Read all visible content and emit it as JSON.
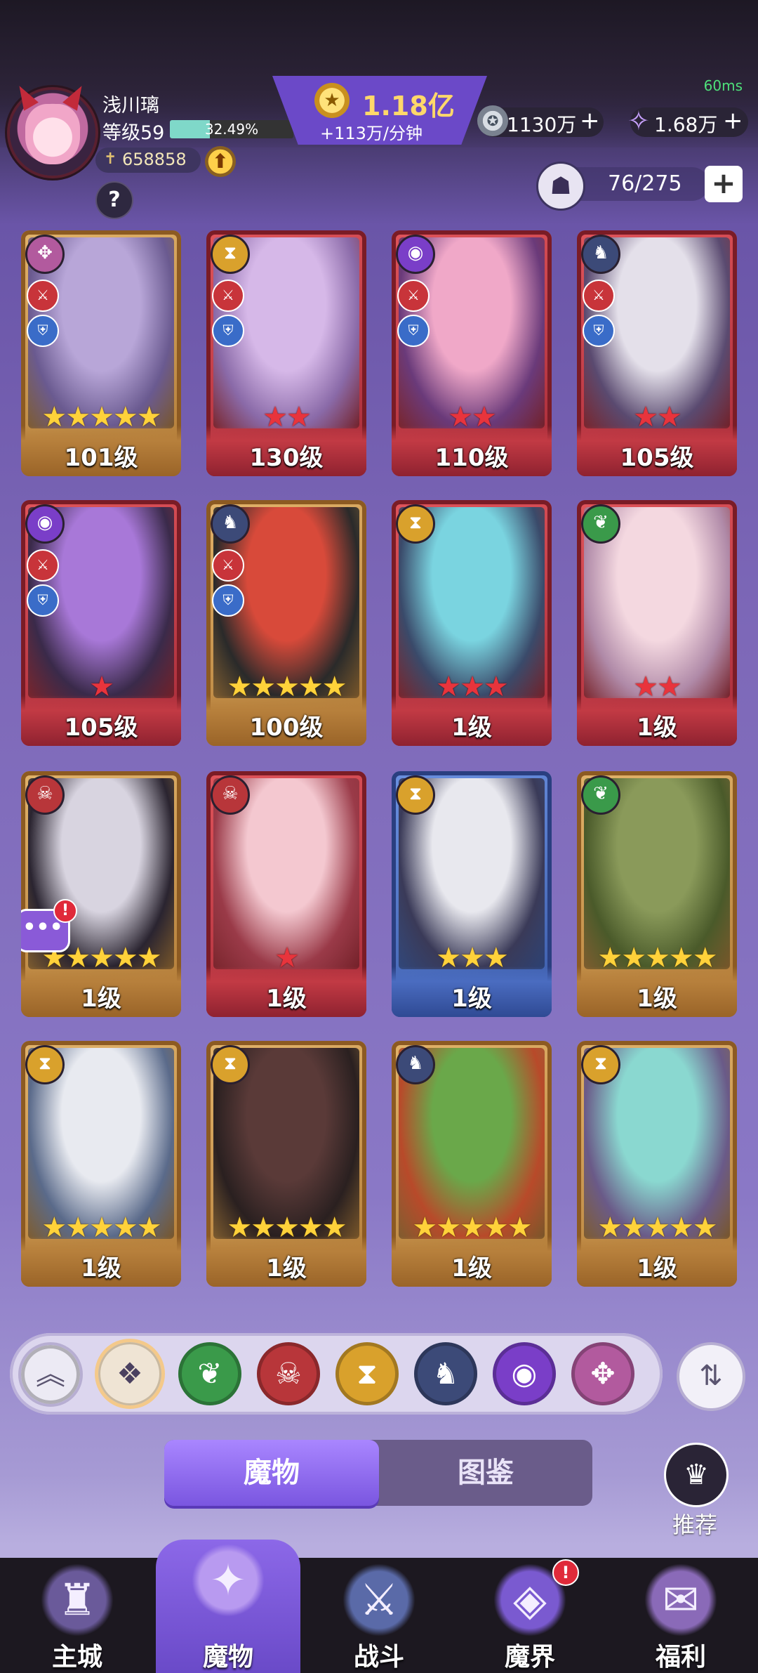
{
  "status": {
    "ping": "60ms"
  },
  "player": {
    "name": "浅川璃",
    "level": "等级59",
    "xp_percent_text": "32.49%",
    "xp_fraction": 0.3249,
    "power": "658858"
  },
  "currencies": {
    "gold": "1.18亿",
    "gold_rate": "+113万/分钟",
    "silver": "1130万",
    "gems": "1.68万",
    "plus": "+"
  },
  "capacity": {
    "text": "76/275",
    "plus": "+"
  },
  "help": "?",
  "factions": {
    "wind": {
      "glyph": "✥",
      "color": "#b25a9e",
      "icon": "wind-swirl-icon"
    },
    "time": {
      "glyph": "⧗",
      "color": "#d9a12c",
      "icon": "hourglass-icon"
    },
    "eye": {
      "glyph": "◉",
      "color": "#7a3ec8",
      "icon": "eye-icon"
    },
    "dragon": {
      "glyph": "♞",
      "color": "#3c4a78",
      "icon": "dragon-icon"
    },
    "leaf": {
      "glyph": "❦",
      "color": "#3a9a4a",
      "icon": "leaf-icon"
    },
    "demon": {
      "glyph": "☠",
      "color": "#b8363a",
      "icon": "demon-mask-icon"
    }
  },
  "cards": [
    {
      "level": "101级",
      "frame": "gold",
      "faction": "wind",
      "stars": 5,
      "star_color": "gold",
      "roles": true,
      "art": [
        "#b8a6d8",
        "#6a5a90"
      ]
    },
    {
      "level": "130级",
      "frame": "red",
      "faction": "time",
      "stars": 2,
      "star_color": "red",
      "roles": true,
      "art": [
        "#d6b8e8",
        "#8a6aa8"
      ]
    },
    {
      "level": "110级",
      "frame": "red",
      "faction": "eye",
      "stars": 2,
      "star_color": "red",
      "roles": true,
      "art": [
        "#f0a8c8",
        "#6a3a7a"
      ]
    },
    {
      "level": "105级",
      "frame": "red",
      "faction": "dragon",
      "stars": 2,
      "star_color": "red",
      "roles": true,
      "art": [
        "#e4e0ea",
        "#5a4a70"
      ]
    },
    {
      "level": "105级",
      "frame": "red",
      "faction": "eye",
      "stars": 1,
      "star_color": "red",
      "roles": true,
      "art": [
        "#a878d8",
        "#3a2a4a"
      ]
    },
    {
      "level": "100级",
      "frame": "gold",
      "faction": "dragon",
      "stars": 5,
      "star_color": "gold",
      "roles": true,
      "art": [
        "#d84a3a",
        "#2a2a2a"
      ]
    },
    {
      "level": "1级",
      "frame": "red",
      "faction": "time",
      "stars": 3,
      "star_color": "red",
      "roles": false,
      "art": [
        "#7ad4e0",
        "#3a4a6a"
      ]
    },
    {
      "level": "1级",
      "frame": "red",
      "faction": "leaf",
      "stars": 2,
      "star_color": "red",
      "roles": false,
      "art": [
        "#f4d8e0",
        "#b08aa8"
      ]
    },
    {
      "level": "1级",
      "frame": "gold",
      "faction": "demon",
      "stars": 5,
      "star_color": "gold",
      "roles": false,
      "art": [
        "#d8d4e0",
        "#2a2430"
      ],
      "chat_notice": true
    },
    {
      "level": "1级",
      "frame": "red",
      "faction": "demon",
      "stars": 1,
      "star_color": "red",
      "roles": false,
      "art": [
        "#f4c8d0",
        "#9a3a48"
      ]
    },
    {
      "level": "1级",
      "frame": "blue",
      "faction": "time",
      "stars": 3,
      "star_color": "gold",
      "roles": false,
      "art": [
        "#e8e8ee",
        "#3a3a58"
      ]
    },
    {
      "level": "1级",
      "frame": "gold",
      "faction": "leaf",
      "stars": 5,
      "star_color": "gold",
      "roles": false,
      "art": [
        "#8a9a5a",
        "#4a5a2a"
      ]
    },
    {
      "level": "1级",
      "frame": "gold",
      "faction": "time",
      "stars": 5,
      "star_color": "gold",
      "roles": false,
      "art": [
        "#e8eaf0",
        "#5a6a8a"
      ]
    },
    {
      "level": "1级",
      "frame": "gold",
      "faction": "time",
      "stars": 5,
      "star_color": "gold",
      "roles": false,
      "art": [
        "#5a3a38",
        "#2a2020"
      ]
    },
    {
      "level": "1级",
      "frame": "gold",
      "faction": "dragon",
      "stars": 5,
      "star_color": "gold",
      "roles": false,
      "art": [
        "#6aa84a",
        "#b84a2a"
      ]
    },
    {
      "level": "1级",
      "frame": "gold",
      "faction": "time",
      "stars": 5,
      "star_color": "gold",
      "roles": false,
      "art": [
        "#8ad8d0",
        "#6a5a88"
      ]
    }
  ],
  "filters": {
    "collapse": "︽",
    "all": "❖",
    "items": [
      "leaf",
      "demon",
      "time",
      "dragon",
      "eye",
      "wind"
    ],
    "sort": "⇅"
  },
  "tabs": {
    "monsters": "魔物",
    "codex": "图鉴"
  },
  "recommend": {
    "label": "推荐",
    "glyph": "♛"
  },
  "nav": [
    {
      "label": "主城",
      "glyph": "♜",
      "color": "#6a5a9a",
      "icon": "castle-icon"
    },
    {
      "label": "魔物",
      "glyph": "✦",
      "color": "#b89af0",
      "icon": "monster-flame-icon",
      "active": true
    },
    {
      "label": "战斗",
      "glyph": "⚔",
      "color": "#5a6aa8",
      "icon": "battle-shield-icon"
    },
    {
      "label": "魔界",
      "glyph": "◈",
      "color": "#7a5ad0",
      "icon": "demon-realm-icon",
      "badge": "!"
    },
    {
      "label": "福利",
      "glyph": "✉",
      "color": "#8a6ab8",
      "icon": "gift-chest-icon"
    }
  ]
}
